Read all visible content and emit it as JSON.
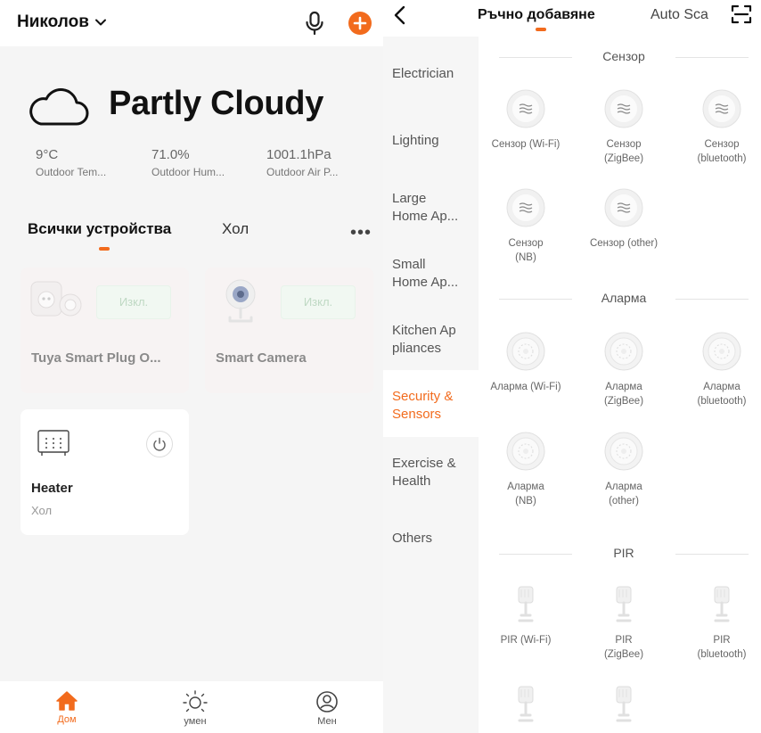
{
  "left": {
    "home_name": "Николов",
    "weather": {
      "condition": "Partly Cloudy",
      "stats": [
        {
          "value": "9°C",
          "label": "Outdoor Tem..."
        },
        {
          "value": "71.0%",
          "label": "Outdoor Hum..."
        },
        {
          "value": "1001.1hPa",
          "label": "Outdoor Air P..."
        }
      ]
    },
    "rooms": {
      "active": "Всички устройства",
      "other": "Хол",
      "more": "•••"
    },
    "devices": [
      {
        "name": "Tuya Smart Plug O...",
        "action": "Изкл.",
        "status": "offline"
      },
      {
        "name": "Smart  Camera",
        "action": "Изкл.",
        "status": "offline"
      },
      {
        "name": "Heater",
        "room": "Хол",
        "status": "online"
      }
    ],
    "bottom_nav": [
      {
        "label": "Дом",
        "icon": "home-icon",
        "active": true
      },
      {
        "label": "умен",
        "icon": "sun-icon",
        "active": false
      },
      {
        "label": "Мен",
        "icon": "profile-icon",
        "active": false
      }
    ],
    "accent": "#f26b1d"
  },
  "right": {
    "tabs": {
      "active": "Ръчно добавяне",
      "other": "Auto Sca"
    },
    "categories": [
      {
        "label": "Electrician",
        "active": false
      },
      {
        "label": "Lighting",
        "active": false
      },
      {
        "label": "Large\nHome Ap...",
        "active": false
      },
      {
        "label": "Small\nHome Ap...",
        "active": false
      },
      {
        "label": "Kitchen Ap\npliances",
        "active": false
      },
      {
        "label": "Security &\nSensors",
        "active": true
      },
      {
        "label": "Exercise &\nHealth",
        "active": false
      },
      {
        "label": "Others",
        "active": false
      }
    ],
    "sections": [
      {
        "title": "Сензор",
        "icon": "sensor-icon",
        "items": [
          "Сензор (Wi-Fi)",
          "Сензор\n(ZigBee)",
          "Сензор\n(bluetooth)",
          "Сензор\n(NB)",
          "Сензор (other)"
        ]
      },
      {
        "title": "Аларма",
        "icon": "alarm-icon",
        "items": [
          "Аларма (Wi-Fi)",
          "Аларма\n(ZigBee)",
          "Аларма\n(bluetooth)",
          "Аларма\n(NB)",
          "Аларма\n(other)"
        ]
      },
      {
        "title": "PIR",
        "icon": "pir-sensor-icon",
        "items": [
          "PIR (Wi-Fi)",
          "PIR\n(ZigBee)",
          "PIR\n(bluetooth)",
          "",
          ""
        ]
      }
    ]
  }
}
